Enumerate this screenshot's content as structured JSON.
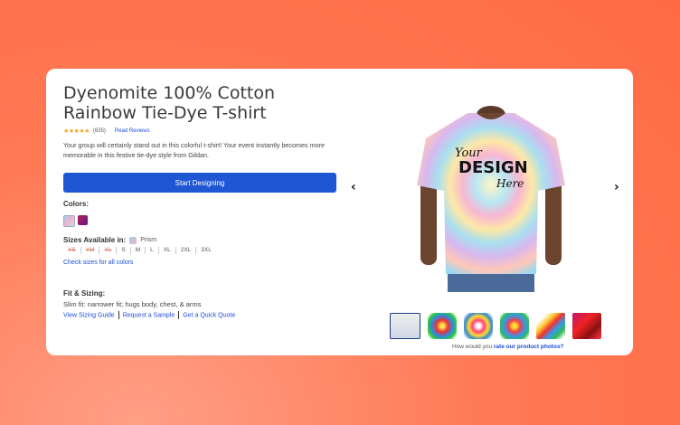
{
  "product": {
    "title_line1": "Dyenomite 100% Cotton",
    "title_line2": "Rainbow Tie-Dye T-shirt",
    "stars": "★★★★★",
    "review_count": "(635)",
    "read_reviews": "Read Reviews",
    "description": "Your group will certainly stand out in this colorful t-shirt! Your event instantly becomes more memorable in this festive tie-dye style from Gildan.",
    "cta_label": "Start Designing"
  },
  "colors": {
    "label": "Colors:",
    "swatches": [
      {
        "name": "prism",
        "color": "#9ecff0"
      },
      {
        "name": "purple-red",
        "color": "#8a1a6a"
      }
    ]
  },
  "sizes": {
    "label": "Sizes Available in:",
    "color_name": "Prism",
    "list": [
      "YS",
      "YM",
      "YL",
      "S",
      "M",
      "L",
      "XL",
      "2XL",
      "3XL"
    ],
    "unavailable": [
      "YS",
      "YM",
      "YL"
    ],
    "check_link": "Check sizes for all colors"
  },
  "fit": {
    "label": "Fit & Sizing:",
    "description": "Slim fit: narrower fit; hugs body, chest, & arms",
    "links": [
      "View Sizing Guide",
      "Request a Sample",
      "Get a Quick Quote"
    ]
  },
  "gallery": {
    "shirt_text": [
      "Your",
      "DESIGN",
      "Here"
    ],
    "prev_icon": "‹",
    "next_icon": "›",
    "rate_prefix": "How would you",
    "rate_link": "rate our product photos?"
  }
}
